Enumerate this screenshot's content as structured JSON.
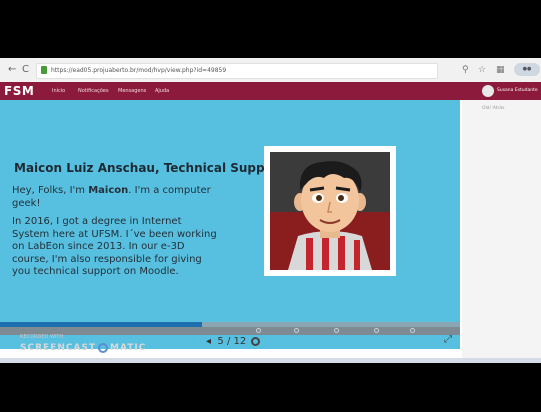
{
  "browser": {
    "url": "https://ead05.projuaberto.br/mod/hvp/view.php?id=49859",
    "nav": {
      "back": "←",
      "reload": "C"
    }
  },
  "navbar": {
    "brand": "FSM",
    "items": [
      "Início",
      "Notificações",
      "Mensagens",
      "Ajuda"
    ],
    "user": "Susana Estudante"
  },
  "slide": {
    "title": "Maicon Luiz Anschau, Technical Support",
    "intro_before": "Hey, Folks, I'm ",
    "intro_name": "Maicon",
    "intro_after": ". I'm a computer geek!",
    "body": "In 2016, I got a degree in Internet System here at UFSM. I´ve been working on LabEon since 2013. In our e-3D course, I'm also responsible for giving you technical support on Moodle.",
    "progress": 0.44,
    "page_current": "5",
    "page_total": "12",
    "page_separator": "/",
    "prev_arrow": "◂"
  },
  "sidebar": {
    "text": "Olá! Atrás"
  },
  "watermark": {
    "small": "RECORDED WITH",
    "big_left": "SCREENCAST",
    "big_right": "MATIC"
  },
  "colors": {
    "navbar": "#8c1a3c",
    "slide_bg": "#57c0e0",
    "progress": "#1d6fb0"
  }
}
